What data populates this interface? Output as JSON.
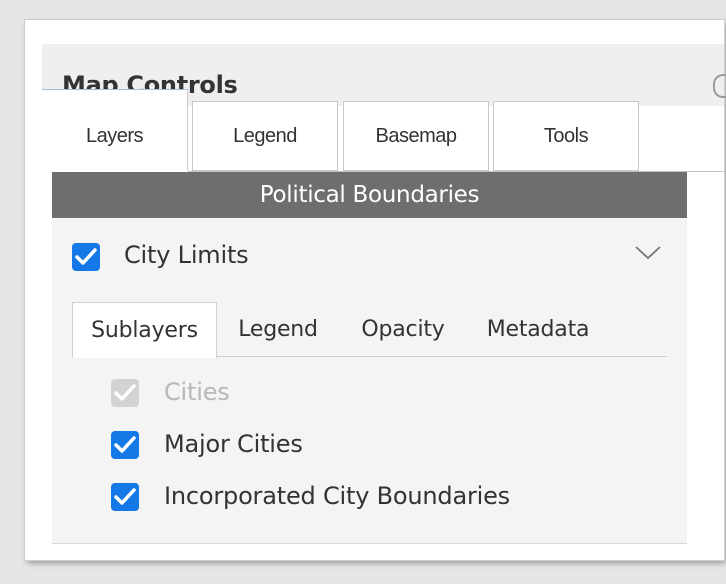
{
  "panel": {
    "title": "Map Controls"
  },
  "top_tabs": [
    {
      "label": "Layers",
      "active": true
    },
    {
      "label": "Legend",
      "active": false
    },
    {
      "label": "Basemap",
      "active": false
    },
    {
      "label": "Tools",
      "active": false
    }
  ],
  "group": {
    "title": "Political Boundaries"
  },
  "layer": {
    "label": "City Limits",
    "checked": true
  },
  "inner_tabs": [
    {
      "label": "Sublayers",
      "active": true
    },
    {
      "label": "Legend",
      "active": false
    },
    {
      "label": "Opacity",
      "active": false
    },
    {
      "label": "Metadata",
      "active": false
    }
  ],
  "sublayers": [
    {
      "label": "Cities",
      "checked": true,
      "disabled": true
    },
    {
      "label": "Major Cities",
      "checked": true,
      "disabled": false
    },
    {
      "label": "Incorporated City Boundaries",
      "checked": true,
      "disabled": false
    }
  ],
  "colors": {
    "accent": "#1479e6",
    "group_header_bg": "#6e6e6e",
    "disabled": "#d3d3d3"
  },
  "icons": {
    "close": "close-icon",
    "expand": "chevron-down-icon",
    "check": "checkmark-icon"
  }
}
